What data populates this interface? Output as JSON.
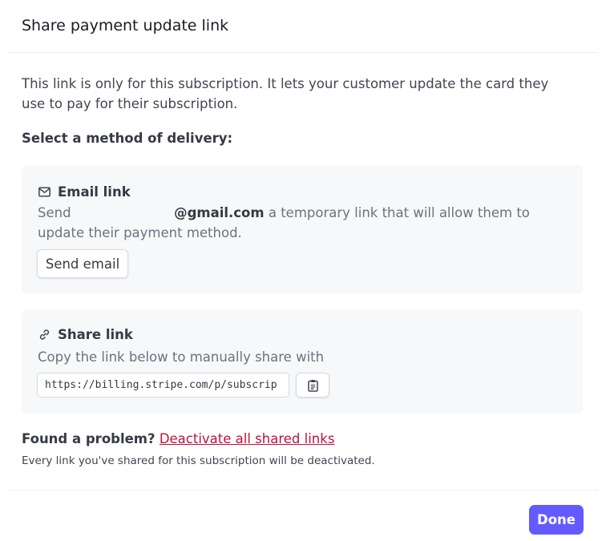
{
  "dialog": {
    "title": "Share payment update link",
    "description": "This link is only for this subscription. It lets your customer update the card they use to pay for their subscription.",
    "select_label": "Select a method of delivery:"
  },
  "email_card": {
    "icon": "mail-icon",
    "title": "Email link",
    "text_before": "Send",
    "email_domain": "@gmail.com",
    "text_after": "a temporary link that will allow them to update their payment method.",
    "button_label": "Send email"
  },
  "share_card": {
    "icon": "link-icon",
    "title": "Share link",
    "text": "Copy the link below to manually share with",
    "link_value": "https://billing.stripe.com/p/subscrip",
    "copy_icon": "clipboard-icon"
  },
  "footer": {
    "problem_question": "Found a problem?",
    "deactivate_link": "Deactivate all shared links",
    "note": "Every link you've shared for this subscription will be deactivated.",
    "done_label": "Done"
  },
  "colors": {
    "accent": "#635bff",
    "danger_link": "#c0123c",
    "card_background": "#f6f8fa"
  }
}
